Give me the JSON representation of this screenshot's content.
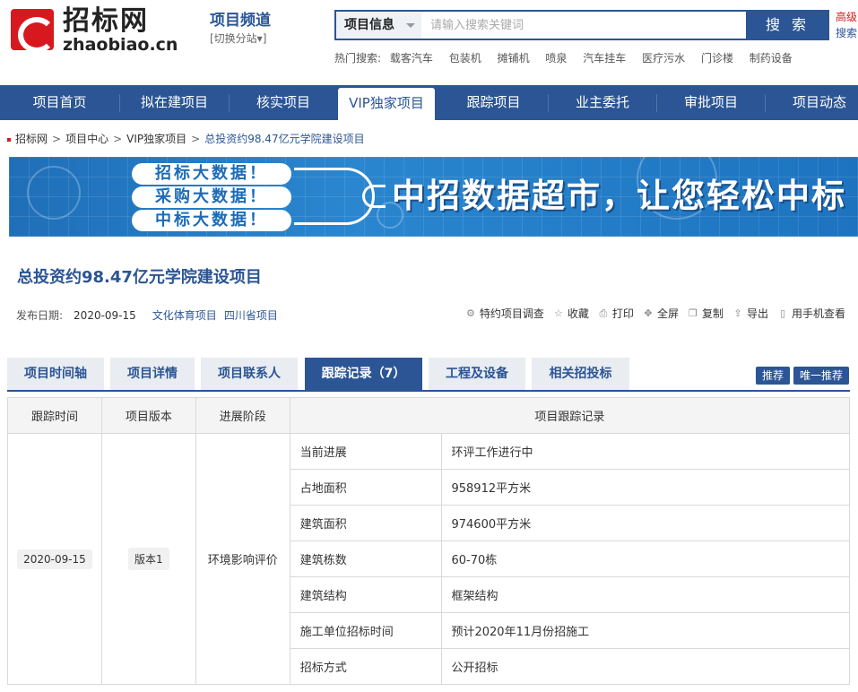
{
  "header": {
    "logo_cn": "招标网",
    "logo_en": "zhaobiao.cn",
    "channel_title": "项目频道",
    "channel_switch": "[切换分站▾]",
    "search": {
      "category": "项目信息",
      "placeholder": "请输入搜索关键词",
      "button": "搜 索"
    },
    "advanced_1": "高级",
    "advanced_2": "搜索",
    "hot_label": "热门搜索:",
    "hot_items": [
      "载客汽车",
      "包装机",
      "摊铺机",
      "喷泉",
      "汽车挂车",
      "医疗污水",
      "门诊楼",
      "制药设备"
    ]
  },
  "nav": {
    "items": [
      "项目首页",
      "拟在建项目",
      "核实项目",
      "VIP独家项目",
      "跟踪项目",
      "业主委托",
      "审批项目",
      "项目动态"
    ],
    "active_index": 3
  },
  "breadcrumb": [
    "招标网",
    "项目中心",
    "VIP独家项目",
    "总投资约98.47亿元学院建设项目"
  ],
  "banner": {
    "pills": [
      "招标大数据！",
      "采购大数据！",
      "中标大数据！"
    ],
    "slogan": "中招数据超市，让您轻松中标"
  },
  "project": {
    "title": "总投资约98.47亿元学院建设项目",
    "date_label": "发布日期:",
    "date": "2020-09-15",
    "tags": [
      "文化体育项目",
      "四川省项目"
    ]
  },
  "tools": [
    {
      "icon": "survey-icon",
      "label": "特约项目调查"
    },
    {
      "icon": "star-icon",
      "label": "收藏"
    },
    {
      "icon": "print-icon",
      "label": "打印"
    },
    {
      "icon": "fullscreen-icon",
      "label": "全屏"
    },
    {
      "icon": "copy-icon",
      "label": "复制"
    },
    {
      "icon": "export-icon",
      "label": "导出"
    },
    {
      "icon": "mobile-icon",
      "label": "用手机查看"
    }
  ],
  "tabs": [
    "项目时间轴",
    "项目详情",
    "项目联系人",
    "跟踪记录（7）",
    "工程及设备",
    "相关招投标"
  ],
  "active_tab": 3,
  "rec_buttons": [
    "推荐",
    "唯一推荐"
  ],
  "table": {
    "headers": [
      "跟踪时间",
      "项目版本",
      "进展阶段",
      "项目跟踪记录"
    ],
    "track_date": "2020-09-15",
    "version": "版本1",
    "stage": "环境影响评价",
    "rows": [
      {
        "k": "当前进展",
        "v": "环评工作进行中"
      },
      {
        "k": "占地面积",
        "v": "958912平方米"
      },
      {
        "k": "建筑面积",
        "v": "974600平方米"
      },
      {
        "k": "建筑栋数",
        "v": "60-70栋"
      },
      {
        "k": "建筑结构",
        "v": "框架结构"
      },
      {
        "k": "施工单位招标时间",
        "v": "预计2020年11月份招施工"
      },
      {
        "k": "招标方式",
        "v": "公开招标"
      }
    ]
  },
  "colors": {
    "brand_blue": "#2b5594",
    "brand_red": "#d7191f"
  }
}
